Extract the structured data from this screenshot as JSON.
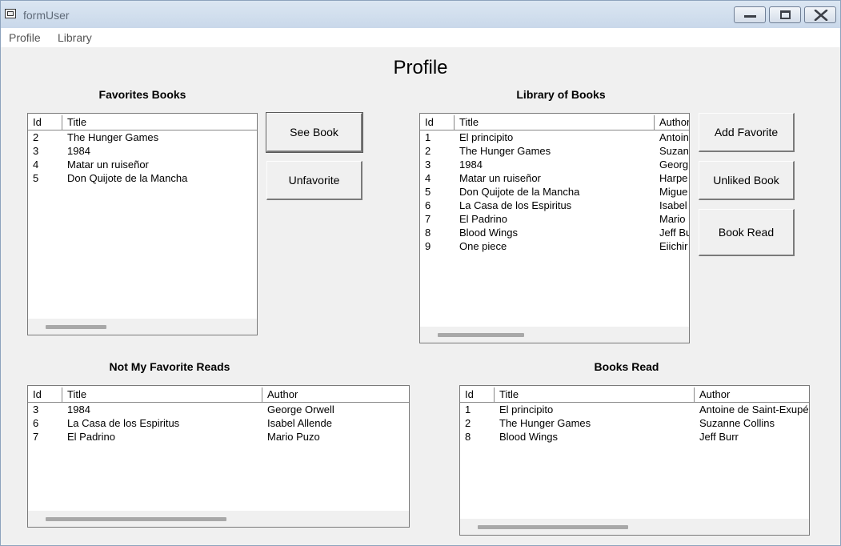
{
  "window": {
    "title": "formUser"
  },
  "menu": {
    "items": [
      "Profile",
      "Library"
    ]
  },
  "page_title": "Profile",
  "favorites": {
    "title": "Favorites Books",
    "columns": [
      "Id",
      "Title"
    ],
    "rows": [
      [
        "2",
        "The Hunger Games"
      ],
      [
        "3",
        "1984"
      ],
      [
        "4",
        "Matar un ruiseñor"
      ],
      [
        "5",
        "Don Quijote de la Mancha"
      ]
    ]
  },
  "library": {
    "title": "Library of Books",
    "columns": [
      "Id",
      "Title",
      "Author"
    ],
    "rows": [
      [
        "1",
        "El principito",
        "Antoin"
      ],
      [
        "2",
        "The Hunger Games",
        "Suzan"
      ],
      [
        "3",
        "1984",
        "Georg"
      ],
      [
        "4",
        "Matar un ruiseñor",
        "Harpe"
      ],
      [
        "5",
        "Don Quijote de la Mancha",
        "Migue"
      ],
      [
        "6",
        "La Casa de los Espiritus",
        "Isabel"
      ],
      [
        "7",
        "El Padrino",
        "Mario"
      ],
      [
        "8",
        "Blood Wings",
        "Jeff Bu"
      ],
      [
        "9",
        "One piece",
        "Eiichir"
      ]
    ]
  },
  "not_favorite": {
    "title": "Not My Favorite Reads",
    "columns": [
      "Id",
      "Title",
      "Author"
    ],
    "rows": [
      [
        "3",
        "1984",
        "George Orwell"
      ],
      [
        "6",
        "La Casa de los Espiritus",
        "Isabel Allende"
      ],
      [
        "7",
        "El Padrino",
        "Mario Puzo"
      ]
    ]
  },
  "books_read": {
    "title": "Books Read",
    "columns": [
      "Id",
      "Title",
      "Author"
    ],
    "rows": [
      [
        "1",
        "El principito",
        "Antoine de Saint-Exupé"
      ],
      [
        "2",
        "The Hunger Games",
        "Suzanne Collins"
      ],
      [
        "8",
        "Blood Wings",
        "Jeff Burr"
      ]
    ]
  },
  "buttons": {
    "see_book": "See Book",
    "unfavorite": "Unfavorite",
    "add_favorite": "Add Favorite",
    "unliked_book": "Unliked Book",
    "book_read": "Book Read"
  }
}
